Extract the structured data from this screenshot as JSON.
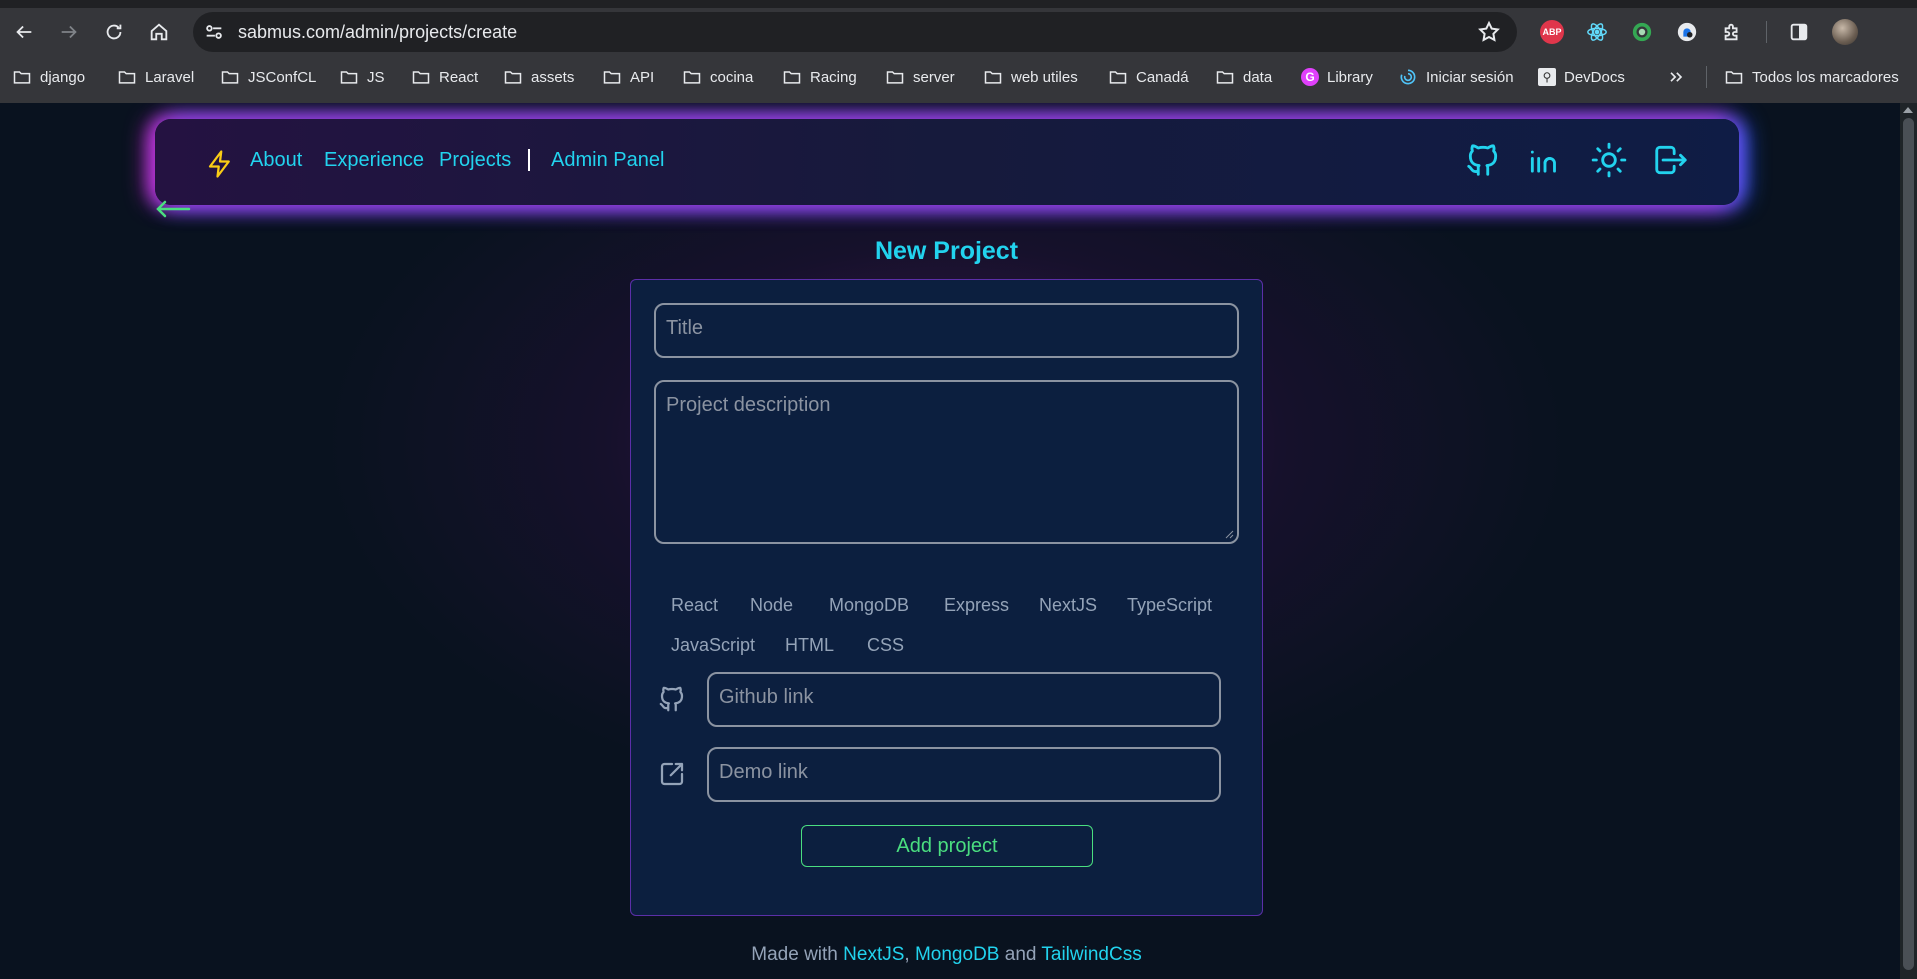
{
  "browser": {
    "url": "sabmus.com/admin/projects/create",
    "extensions": [
      "adblock-plus",
      "react-devtools",
      "extension-green-circle",
      "extension-blue",
      "extensions-puzzle"
    ],
    "abp_label": "ABP",
    "bookmarks": [
      {
        "label": "django",
        "icon": "folder-icon"
      },
      {
        "label": "Laravel",
        "icon": "folder-icon"
      },
      {
        "label": "JSConfCL",
        "icon": "folder-icon"
      },
      {
        "label": "JS",
        "icon": "folder-icon"
      },
      {
        "label": "React",
        "icon": "folder-icon"
      },
      {
        "label": "assets",
        "icon": "folder-icon"
      },
      {
        "label": "API",
        "icon": "folder-icon"
      },
      {
        "label": "cocina",
        "icon": "folder-icon"
      },
      {
        "label": "Racing",
        "icon": "folder-icon"
      },
      {
        "label": "server",
        "icon": "folder-icon"
      },
      {
        "label": "web utiles",
        "icon": "folder-icon"
      },
      {
        "label": "Canadá",
        "icon": "folder-icon"
      },
      {
        "label": "data",
        "icon": "folder-icon"
      },
      {
        "label": "Library",
        "icon": "g-icon"
      },
      {
        "label": "Iniciar sesión",
        "icon": "swirl-icon"
      },
      {
        "label": "DevDocs",
        "icon": "devdocs-icon"
      }
    ],
    "all_bookmarks": "Todos los marcadores",
    "g_letter": "G"
  },
  "nav": {
    "links": [
      "About",
      "Experience",
      "Projects"
    ],
    "admin": "Admin Panel",
    "icons": [
      "github-icon",
      "linkedin-icon",
      "sun-icon",
      "logout-icon"
    ]
  },
  "form": {
    "title": "New Project",
    "title_placeholder": "Title",
    "description_placeholder": "Project description",
    "technologies": [
      "React",
      "Node",
      "MongoDB",
      "Express",
      "NextJS",
      "TypeScript",
      "JavaScript",
      "HTML",
      "CSS"
    ],
    "github_placeholder": "Github link",
    "demo_placeholder": "Demo link",
    "submit": "Add project"
  },
  "footer": {
    "prefix": "Made with ",
    "tech1": "NextJS",
    "sep1": ", ",
    "tech2": "MongoDB",
    "sep2": " and ",
    "tech3": "TailwindCss"
  },
  "colors": {
    "accent": "#22d3ee",
    "button": "#4ade80",
    "bolt": "#facc15",
    "card": "#0c1f3f"
  }
}
